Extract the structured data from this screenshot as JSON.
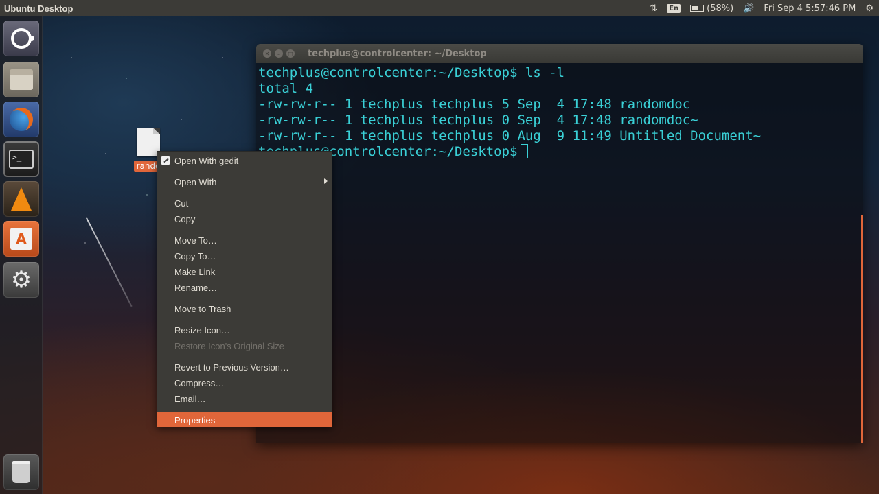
{
  "top_panel": {
    "app_title": "Ubuntu Desktop",
    "keyboard_indicator": "En",
    "battery_text": "(58%)",
    "datetime": "Fri Sep  4  5:57:46 PM"
  },
  "launcher": {
    "items": [
      {
        "icon": "ubuntu-logo-icon",
        "label": "Dash"
      },
      {
        "icon": "files-icon",
        "label": "Files"
      },
      {
        "icon": "firefox-icon",
        "label": "Firefox"
      },
      {
        "icon": "terminal-icon",
        "label": "Terminal"
      },
      {
        "icon": "vlc-icon",
        "label": "VLC"
      },
      {
        "icon": "software-center-icon",
        "label": "Software Center"
      },
      {
        "icon": "system-settings-icon",
        "label": "System Settings"
      },
      {
        "icon": "trash-icon",
        "label": "Trash"
      }
    ],
    "terminal_glyph": ">_",
    "software_glyph": "A"
  },
  "desktop_icon": {
    "label": "rando"
  },
  "terminal": {
    "title": "techplus@controlcenter: ~/Desktop",
    "lines": [
      "techplus@controlcenter:~/Desktop$ ls -l",
      "total 4",
      "-rw-rw-r-- 1 techplus techplus 5 Sep  4 17:48 randomdoc",
      "-rw-rw-r-- 1 techplus techplus 0 Sep  4 17:48 randomdoc~",
      "-rw-rw-r-- 1 techplus techplus 0 Aug  9 11:49 Untitled Document~"
    ],
    "prompt": "techplus@controlcenter:~/Desktop$"
  },
  "context_menu": {
    "items": [
      {
        "label": "Open With gedit",
        "state": "normal"
      },
      {
        "label": "Open With",
        "state": "normal",
        "submenu": true
      },
      {
        "label": "Cut",
        "state": "normal"
      },
      {
        "label": "Copy",
        "state": "normal"
      },
      {
        "label": "Move To…",
        "state": "normal"
      },
      {
        "label": "Copy To…",
        "state": "normal"
      },
      {
        "label": "Make Link",
        "state": "normal"
      },
      {
        "label": "Rename…",
        "state": "normal"
      },
      {
        "label": "Move to Trash",
        "state": "normal"
      },
      {
        "label": "Resize Icon…",
        "state": "normal"
      },
      {
        "label": "Restore Icon's Original Size",
        "state": "disabled"
      },
      {
        "label": "Revert to Previous Version…",
        "state": "normal"
      },
      {
        "label": "Compress…",
        "state": "normal"
      },
      {
        "label": "Email…",
        "state": "normal"
      },
      {
        "label": "Properties",
        "state": "highlighted"
      }
    ]
  },
  "colors": {
    "panel": "#3c3b37",
    "accent": "#e0663a",
    "terminal_text": "#3ad0d6"
  }
}
